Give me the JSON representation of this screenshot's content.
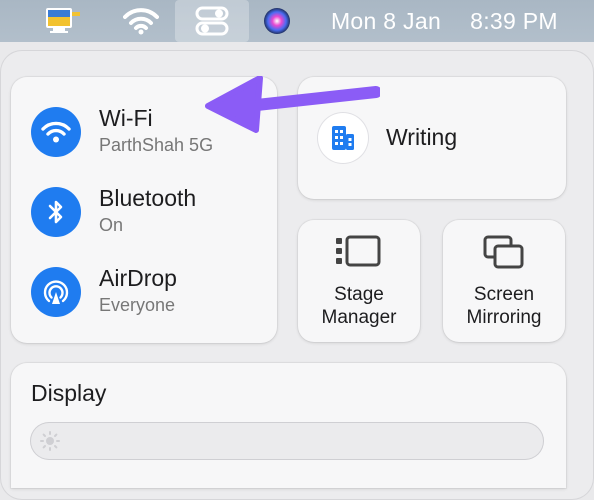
{
  "menubar": {
    "date": "Mon 8 Jan",
    "time": "8:39 PM",
    "icons": [
      "app-icon",
      "wifi-icon",
      "control-center-icon",
      "siri-icon"
    ]
  },
  "network": {
    "wifi": {
      "title": "Wi-Fi",
      "subtitle": "ParthShah 5G"
    },
    "bluetooth": {
      "title": "Bluetooth",
      "subtitle": "On"
    },
    "airdrop": {
      "title": "AirDrop",
      "subtitle": "Everyone"
    }
  },
  "focus": {
    "label": "Writing"
  },
  "stage_manager": {
    "line1": "Stage",
    "line2": "Manager"
  },
  "screen_mirroring": {
    "line1": "Screen",
    "line2": "Mirroring"
  },
  "display": {
    "title": "Display"
  },
  "colors": {
    "accent": "#1f7cf0",
    "annotation_arrow": "#8b5cf6"
  }
}
